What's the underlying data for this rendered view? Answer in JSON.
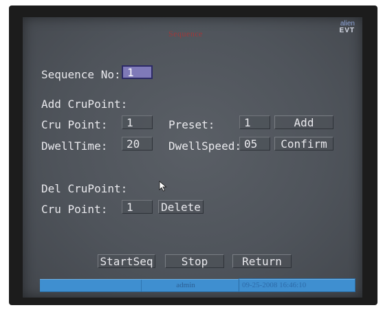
{
  "window": {
    "title": "Sequence",
    "logo_line1": "alien",
    "logo_line2": "EVT"
  },
  "sequence": {
    "label": "Sequence No:",
    "value": "1"
  },
  "add_section": {
    "header": "Add CruPoint:",
    "cru_point_label": "Cru Point:",
    "cru_point_value": "1",
    "preset_label": "Preset:",
    "preset_value": "1",
    "add_button": "Add",
    "dwell_time_label": "DwellTime:",
    "dwell_time_value": "20",
    "dwell_speed_label": "DwellSpeed:",
    "dwell_speed_value": "05",
    "confirm_button": "Confirm"
  },
  "del_section": {
    "header": "Del CruPoint:",
    "cru_point_label": "Cru Point:",
    "cru_point_value": "1",
    "delete_button": "Delete"
  },
  "actions": {
    "start": "StartSeq",
    "stop": "Stop",
    "return": "Return"
  },
  "status_bar": {
    "user": "admin",
    "datetime": "09-25-2008 16:46:10"
  },
  "colors": {
    "screen_bg": "#53585f",
    "selection": "#7f7ab8",
    "title_red": "#a0383a",
    "status_blue": "#3f8fd0"
  }
}
